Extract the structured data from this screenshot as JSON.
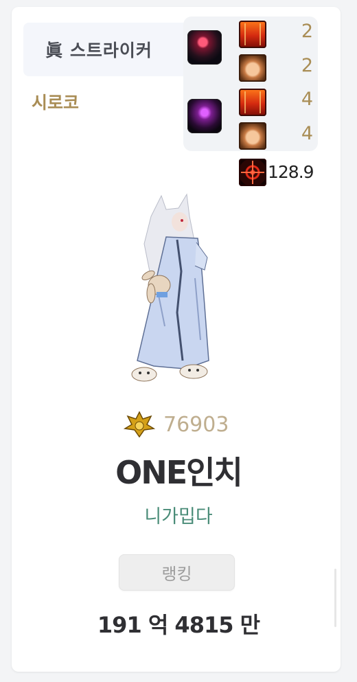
{
  "job": {
    "label": "眞 스트라이커"
  },
  "server": {
    "label": "시로코"
  },
  "buffs": {
    "rows": [
      {
        "avatar": "dark-red-creature-avatar",
        "items": [
          {
            "icon": "red-card-icon",
            "count": "2"
          },
          {
            "icon": "brown-face-icon",
            "count": "2"
          }
        ]
      },
      {
        "avatar": "purple-creature-avatar",
        "items": [
          {
            "icon": "red-card-icon",
            "count": "4"
          },
          {
            "icon": "brown-face-icon",
            "count": "4"
          }
        ]
      }
    ],
    "stat": {
      "icon": "crosshair-icon",
      "value": "128.9"
    }
  },
  "character": {
    "sprite": "white-haired-character-with-bunny",
    "fame_icon": "gold-crest-icon",
    "fame": "76903",
    "name": "ONE인치",
    "guild": "니가밉다"
  },
  "rank_button": {
    "label": "랭킹"
  },
  "damage": {
    "value": "191 억 4815 만"
  },
  "colors": {
    "accent_gold": "#a98d55",
    "guild_green": "#4a8c78",
    "text_dark": "#2f2f33",
    "fame_text": "#bfae8f"
  }
}
